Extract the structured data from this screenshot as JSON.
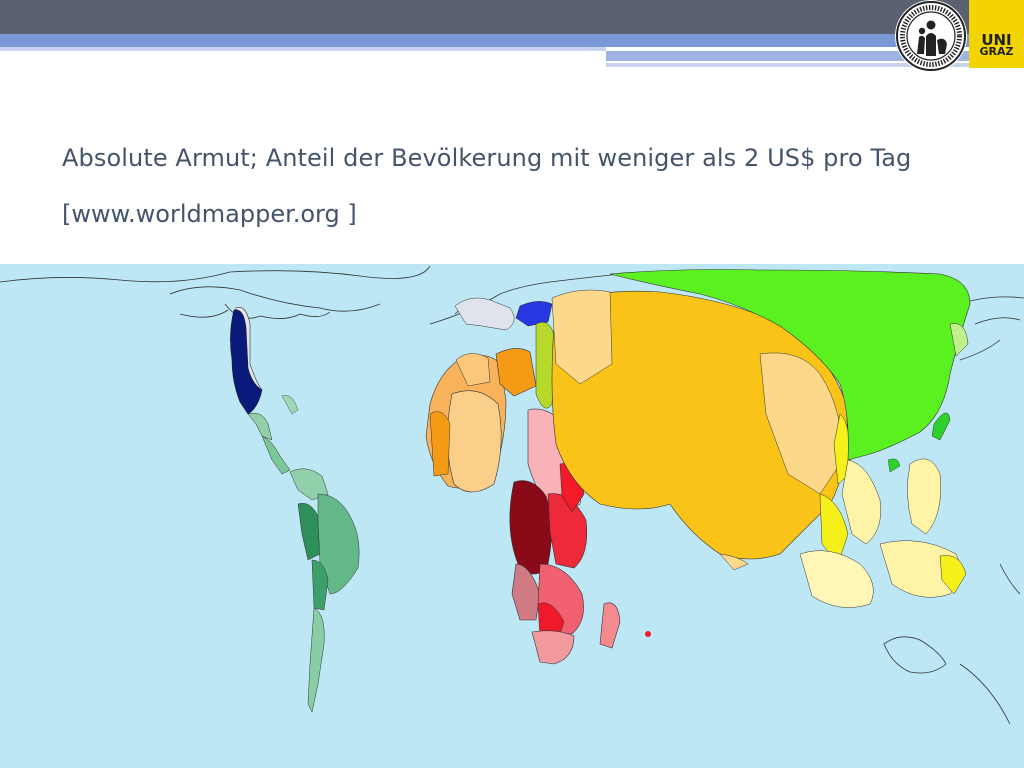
{
  "title": "Absolute Armut; Anteil der Bevölkerung mit weniger als 2 US$ pro Tag",
  "source": "[www.worldmapper.org ]",
  "logo": {
    "line1": "UNI",
    "line2": "GRAZ",
    "seal_text": "UNIVERSITAS GRAECENSIS · UNIVERSITÄT GRAZ"
  },
  "colors": {
    "header_dark": "#5a6170",
    "header_blue": "#7a97d6",
    "logo_yellow": "#f4d400",
    "title_text": "#44546a",
    "ocean": "#bde7f4"
  }
}
